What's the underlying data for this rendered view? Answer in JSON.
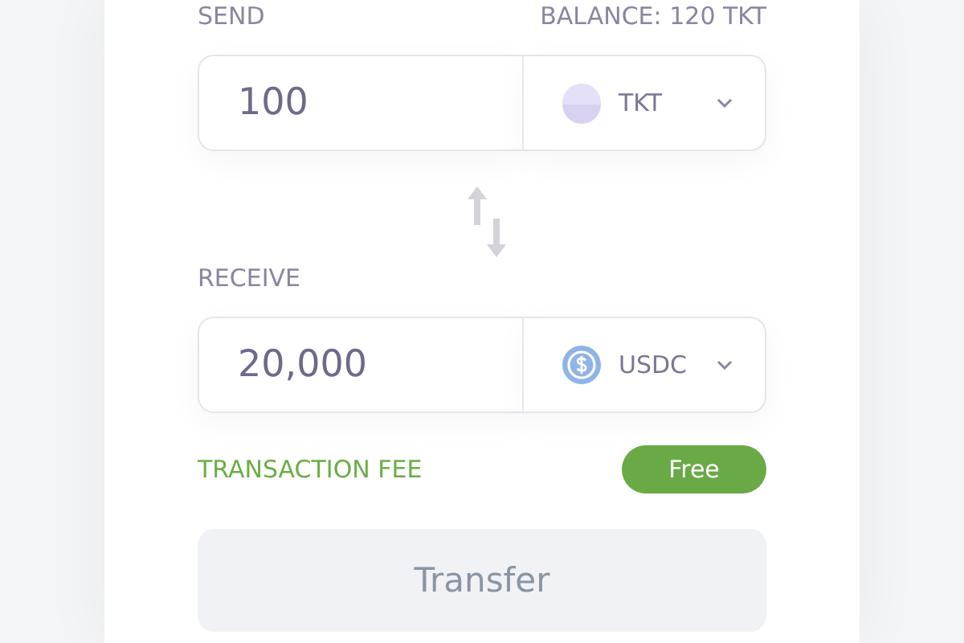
{
  "send": {
    "label": "SEND",
    "balance": "BALANCE: 120 TKT",
    "amount": "100",
    "token": {
      "kind": "plain",
      "symbol": "TKT"
    }
  },
  "receive": {
    "label": "RECEIVE",
    "amount": "20,000",
    "token": {
      "kind": "usdc",
      "symbol": "USDC"
    }
  },
  "fee": {
    "label": "TRANSACTION FEE",
    "value": "Free"
  },
  "transfer": {
    "label": "Transfer",
    "disabled": true
  }
}
